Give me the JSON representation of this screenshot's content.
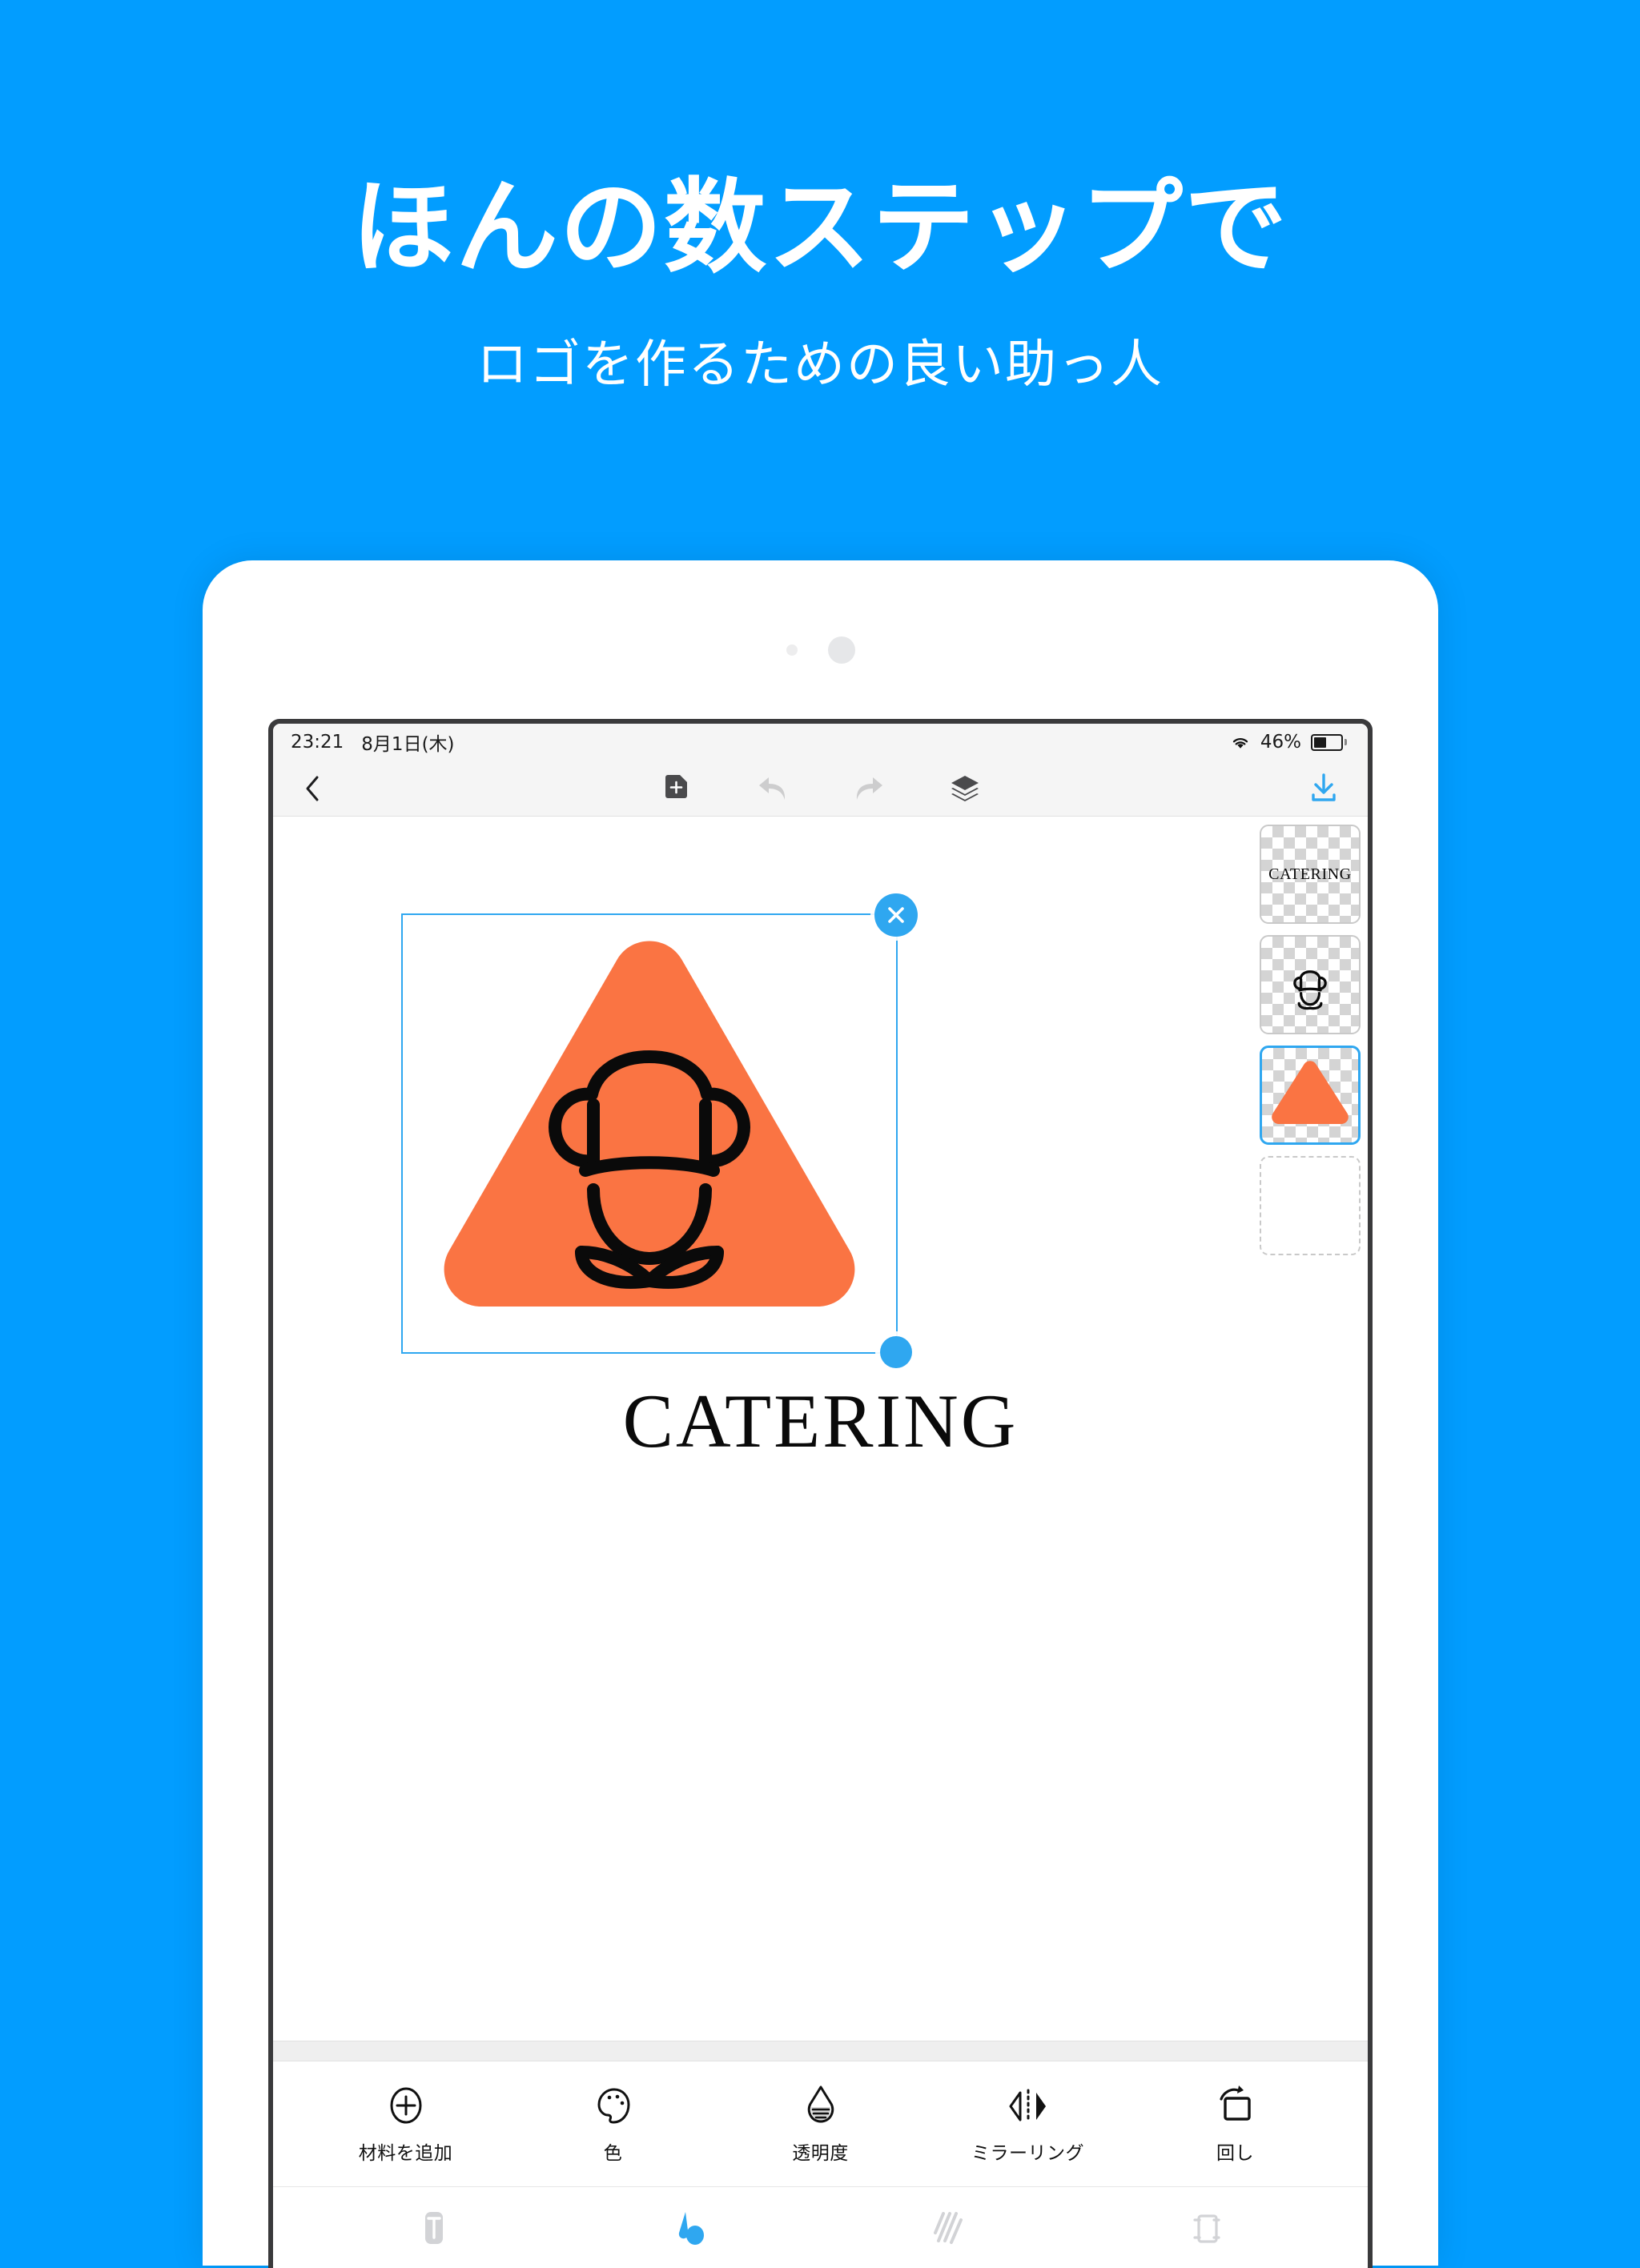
{
  "promo": {
    "title": "ほんの数ステップで",
    "subtitle": "ロゴを作るための良い助っ人",
    "background_color": "#029DFF"
  },
  "status_bar": {
    "time": "23:21",
    "date": "8月1日(木)",
    "battery_percent": "46%",
    "battery_level": 46,
    "wifi_icon": "wifi-icon",
    "battery_icon": "battery-icon"
  },
  "toolbar": {
    "back_icon": "chevron-left-icon",
    "add_page_icon": "add-page-icon",
    "undo_icon": "undo-arrow-icon",
    "redo_icon": "redo-arrow-icon",
    "layers_icon": "layers-stack-icon",
    "download_icon": "download-icon",
    "accent_color": "#2FA7F0"
  },
  "canvas": {
    "logo_text": "CATERING",
    "shape_color": "#FA7443",
    "selection_color": "#2FA7F0",
    "close_icon": "close-x-icon",
    "resize_handle_icon": "resize-handle-icon"
  },
  "layers": [
    {
      "name": "catering-text-layer",
      "preview_text": "CATERING",
      "type": "text",
      "selected": false
    },
    {
      "name": "chef-hat-layer",
      "preview_text": "",
      "type": "chef-hat-icon",
      "selected": false
    },
    {
      "name": "triangle-shape-layer",
      "preview_text": "",
      "type": "triangle-shape",
      "selected": true
    },
    {
      "name": "blank-layer",
      "preview_text": "",
      "type": "blank",
      "selected": false
    }
  ],
  "tools": [
    {
      "label": "材料を追加",
      "icon": "plus-circle-icon",
      "name": "add-material-tool"
    },
    {
      "label": "色",
      "icon": "palette-icon",
      "name": "color-tool"
    },
    {
      "label": "透明度",
      "icon": "opacity-drop-icon",
      "name": "opacity-tool"
    },
    {
      "label": "ミラーリング",
      "icon": "mirror-icon",
      "name": "mirror-tool"
    },
    {
      "label": "回し",
      "icon": "rotate-icon",
      "name": "rotate-tool"
    }
  ],
  "tabs": [
    {
      "name": "tab-text",
      "icon": "text-t-icon",
      "active": false
    },
    {
      "name": "tab-shape",
      "icon": "shape-droplet-icon",
      "active": true
    },
    {
      "name": "tab-pattern",
      "icon": "pattern-stripes-icon",
      "active": false
    },
    {
      "name": "tab-crop",
      "icon": "crop-icon",
      "active": false
    }
  ]
}
